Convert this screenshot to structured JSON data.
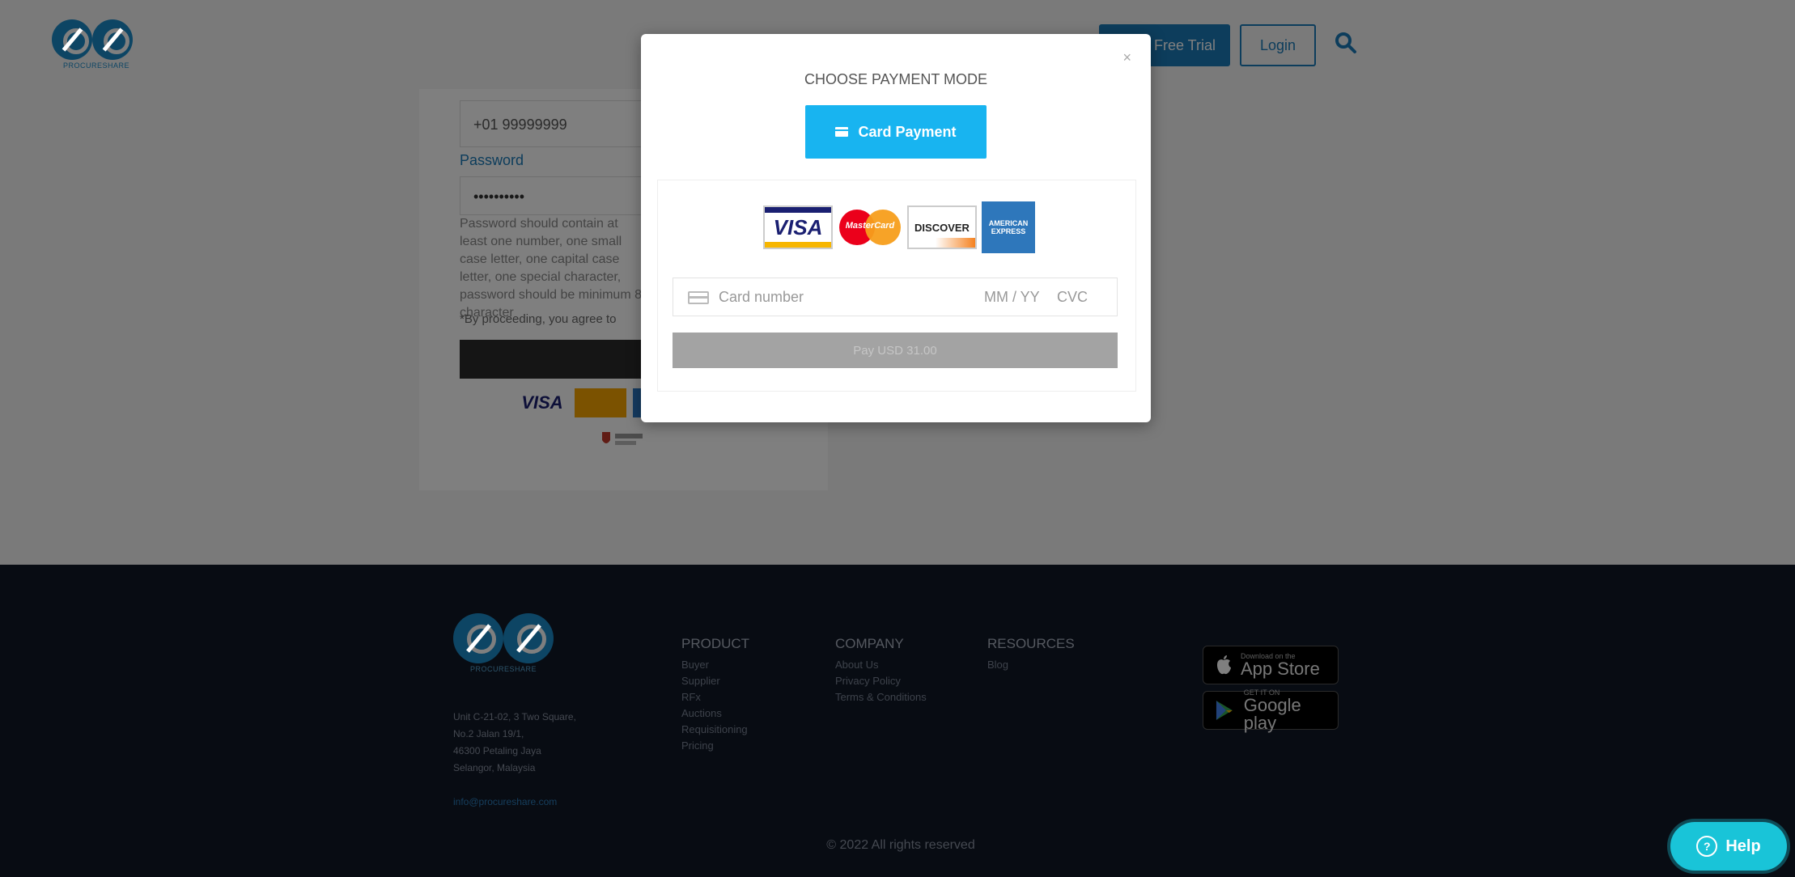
{
  "header": {
    "logo_text": "PROCURESHARE",
    "trial_button": "Free Trial",
    "login_button": "Login"
  },
  "form": {
    "phone_value": "+01 99999999",
    "password_label": "Password",
    "password_value": "••••••••••",
    "password_help": "Password should contain at least one number, one small case letter, one capital case letter, one special character, password should be minimum 8 character",
    "agree_text": "*By proceeding, you agree to"
  },
  "modal": {
    "title": "CHOOSE PAYMENT MODE",
    "card_payment_button": "Card Payment",
    "close": "×",
    "card_logos": {
      "visa": "VISA",
      "mastercard": "MasterCard",
      "discover": "DISCOVER",
      "amex": "AMERICAN EXPRESS"
    },
    "card_number_placeholder": "Card number",
    "expiry_placeholder": "MM / YY",
    "cvc_placeholder": "CVC",
    "pay_button": "Pay USD 31.00"
  },
  "footer": {
    "logo_text": "PROCURESHARE",
    "address": [
      "Unit C-21-02, 3 Two Square,",
      "No.2 Jalan 19/1,",
      "46300 Petaling Jaya",
      "Selangor, Malaysia"
    ],
    "email": "info@procureshare.com",
    "columns": [
      {
        "title": "PRODUCT",
        "items": [
          "Buyer",
          "Supplier",
          "RFx",
          "Auctions",
          "Requisitioning",
          "Pricing"
        ]
      },
      {
        "title": "COMPANY",
        "items": [
          "About Us",
          "Privacy Policy",
          "Terms & Conditions"
        ]
      },
      {
        "title": "RESOURCES",
        "items": [
          "Blog"
        ]
      }
    ],
    "app_store": {
      "small": "Download on the",
      "big": "App Store"
    },
    "google_play": {
      "small": "GET IT ON",
      "big": "Google play"
    },
    "copyright": "© 2022 All rights reserved"
  },
  "help_button": "Help",
  "colors": {
    "brand": "#1a8bc9",
    "modal_accent": "#18b4f0",
    "footer_bg": "#111826",
    "help": "#19c4d8"
  }
}
